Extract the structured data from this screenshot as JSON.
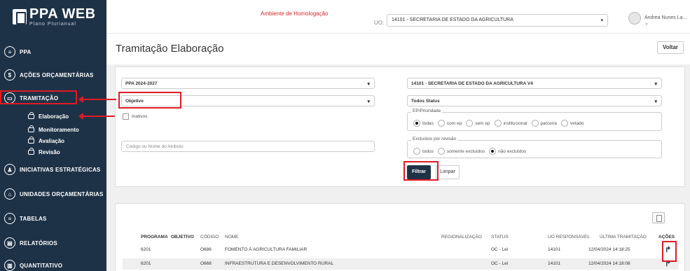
{
  "sidebar": {
    "logo": {
      "title": "PPA WEB",
      "subtitle": "Plano Plurianual"
    },
    "items": [
      {
        "label": "PPA",
        "icon": "book-icon",
        "glyph": "≡"
      },
      {
        "label": "AÇÕES ORÇAMENTÁRIAS",
        "icon": "dollar-icon",
        "glyph": "$"
      },
      {
        "label": "TRAMITAÇÃO",
        "icon": "inbox-icon",
        "glyph": "▭"
      },
      {
        "label": "INICIATIVAS ESTRATÉGICAS",
        "icon": "people-icon",
        "glyph": "♟"
      },
      {
        "label": "UNIDADES ORÇAMENTÁRIAS",
        "icon": "building-icon",
        "glyph": "⌂"
      },
      {
        "label": "TABELAS",
        "icon": "list-icon",
        "glyph": "≡"
      },
      {
        "label": "RELATÓRIOS",
        "icon": "document-icon",
        "glyph": "▤"
      },
      {
        "label": "QUANTITATIVO",
        "icon": "chart-icon",
        "glyph": "▥"
      }
    ],
    "sub_items": [
      "Elaboração",
      "Monitoramento",
      "Avaliação",
      "Revisão"
    ]
  },
  "topbar": {
    "environment": "Ambiente de Homologação",
    "uo_label": "UO:",
    "uo_value": "14101 - SECRETARIA DE ESTADO DA AGRICULTURA",
    "user": "Andrea Nunes La...",
    "user_caret": "⌄"
  },
  "page": {
    "title": "Tramitação Elaboração",
    "back_label": "Voltar"
  },
  "filters": {
    "ppa": "PPA 2024-2027",
    "tipo": "Objetivo",
    "inativos": "Inativos",
    "atributo_placeholder": "Código ou Nome do Atributo",
    "uo": "14101 - SECRETARIA DE ESTADO DA AGRICULTURA V4",
    "status": "Todos Status",
    "ep_legend": "EP/Prioridade",
    "ep_options": [
      "todas",
      "com ep",
      "sem ep",
      "institucional",
      "parceria",
      "vetado"
    ],
    "ep_selected": "todas",
    "excl_legend": "Excluídos por revisão",
    "excl_options": [
      "todos",
      "somente excluídos",
      "não excluídos"
    ],
    "excl_selected": "não excluídos",
    "filter_label": "Filtrar",
    "clear_label": "Limpar",
    "caret": "▾"
  },
  "table": {
    "headers": {
      "programa": "PROGRAMA",
      "objetivo": "OBJETIVO",
      "codigo": "CÓDIGO",
      "nome": "NOME",
      "regionalizacao": "REGIONALIZAÇÃO",
      "status": "STATUS",
      "uo": "UO RESPONSÁVEL",
      "ultima": "ÚLTIMA TRAMITAÇÃO",
      "acoes": "AÇÕES"
    },
    "rows": [
      {
        "programa": "6201",
        "codigo": "O686",
        "nome": "FOMENTO À AGRICULTURA FAMILIAR",
        "status": "OC - Lei",
        "uo": "14101",
        "ultima": "12/04/2024 14:18:25",
        "acao": "↱"
      },
      {
        "programa": "6201",
        "codigo": "O668",
        "nome": "INFRAESTRUTURA E DESENVOLVIMENTO RURAL",
        "status": "OC - Lei",
        "uo": "14101",
        "ultima": "12/04/2024 14:18:08",
        "acao": "↱"
      }
    ]
  },
  "colors": {
    "sidebar": "#1e3247",
    "accent_red": "#e01b22",
    "environment": "#d9262c"
  }
}
